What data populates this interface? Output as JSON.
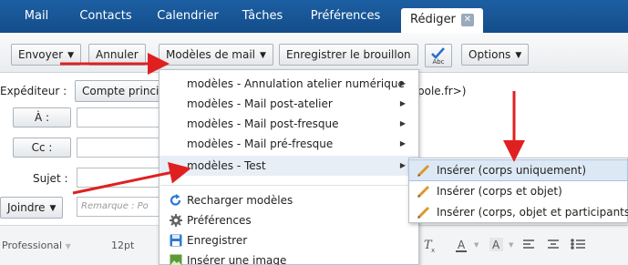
{
  "tabs": {
    "mail": "Mail",
    "contacts": "Contacts",
    "calendar": "Calendrier",
    "tasks": "Tâches",
    "prefs": "Préférences",
    "compose": "Rédiger",
    "compose_close": "✕"
  },
  "toolbar": {
    "send": "Envoyer",
    "cancel": "Annuler",
    "templates": "Modèles de mail",
    "save_draft": "Enregistrer le brouillon",
    "spell_label": "Abc",
    "options": "Options"
  },
  "form": {
    "sender_label": "Expéditeur :",
    "sender_value": "Compte princip",
    "sender_tail": "pole.fr>)",
    "to_button": "À :",
    "cc_button": "Cc :",
    "subject_label": "Sujet :",
    "attach_button": "Joindre",
    "remark_placeholder": "Remarque : Po"
  },
  "editor": {
    "font": "Professional",
    "size": "12pt"
  },
  "templates_menu": {
    "items": [
      "modèles - Annulation atelier numérique",
      "modèles - Mail post-atelier",
      "modèles - Mail post-fresque",
      "modèles - Mail pré-fresque",
      "modèles - Test"
    ],
    "actions": [
      "Recharger modèles",
      "Préférences",
      "Enregistrer",
      "Insérer une image"
    ]
  },
  "insert_submenu": {
    "items": [
      "Insérer (corps uniquement)",
      "Insérer (corps et objet)",
      "Insérer (corps, objet et participants)"
    ]
  },
  "colors": {
    "tabbar": "#1d5fa3",
    "arrow": "#e02020",
    "highlight": "#dde8f5"
  }
}
